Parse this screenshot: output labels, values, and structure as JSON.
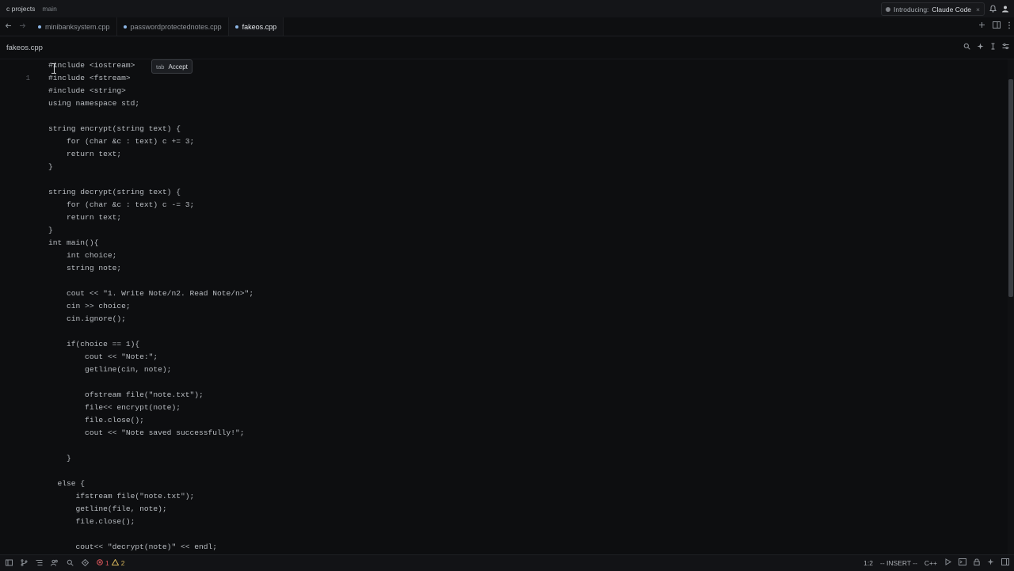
{
  "titlebar": {
    "project": "c projects",
    "branch": "main",
    "promo_prefix": "Introducing:",
    "promo_name": "Claude Code",
    "promo_close": "×"
  },
  "tabs": [
    {
      "label": "minibanksystem.cpp",
      "active": false
    },
    {
      "label": "passwordprotectednotes.cpp",
      "active": false
    },
    {
      "label": "fakeos.cpp",
      "active": true
    }
  ],
  "breadcrumb": {
    "file": "fakeos.cpp"
  },
  "editor": {
    "first_line_number": "1",
    "lines": [
      "#include <iostream>",
      "#include <fstream>",
      "#include <string>",
      "using namespace std;",
      "",
      "string encrypt(string text) {",
      "    for (char &c : text) c += 3;",
      "    return text;",
      "}",
      "",
      "string decrypt(string text) {",
      "    for (char &c : text) c -= 3;",
      "    return text;",
      "}",
      "int main(){",
      "    int choice;",
      "    string note;",
      "",
      "    cout << \"1. Write Note/n2. Read Note/n>\";",
      "    cin >> choice;",
      "    cin.ignore();",
      "",
      "    if(choice == 1){",
      "        cout << \"Note:\";",
      "        getline(cin, note);",
      "",
      "        ofstream file(\"note.txt\");",
      "        file<< encrypt(note);",
      "        file.close();",
      "        cout << \"Note saved successfully!\";",
      "",
      "    }",
      "",
      "  else {",
      "      ifstream file(\"note.txt\");",
      "      getline(file, note);",
      "      file.close();",
      "",
      "      cout<< \"decrypt(note)\" << endl;"
    ]
  },
  "completion": {
    "key": "tab",
    "label": "Accept"
  },
  "statusbar": {
    "errors": "1",
    "warnings": "2",
    "position": "1:2",
    "mode": "-- INSERT --",
    "language": "C++"
  }
}
